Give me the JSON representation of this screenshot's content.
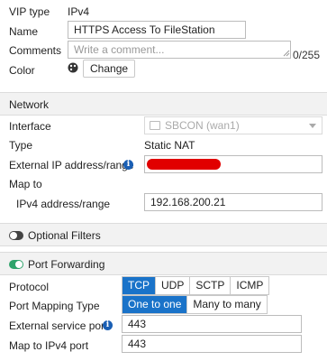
{
  "vip_type": {
    "label": "VIP type",
    "value": "IPv4"
  },
  "name": {
    "label": "Name",
    "value": "HTTPS Access To FileStation"
  },
  "comments": {
    "label": "Comments",
    "placeholder": "Write a comment...",
    "counter": "0/255"
  },
  "color": {
    "label": "Color",
    "button": "Change"
  },
  "network": {
    "title": "Network",
    "interface": {
      "label": "Interface",
      "value": "SBCON (wan1)"
    },
    "type": {
      "label": "Type",
      "value": "Static NAT"
    },
    "external_ip": {
      "label": "External IP address/range"
    },
    "map_to": {
      "label": "Map to"
    },
    "ipv4_range": {
      "label": "IPv4 address/range",
      "value": "192.168.200.21"
    }
  },
  "optional_filters": {
    "title": "Optional Filters",
    "enabled": false
  },
  "port_forwarding": {
    "title": "Port Forwarding",
    "enabled": true,
    "protocol": {
      "label": "Protocol",
      "options": [
        "TCP",
        "UDP",
        "SCTP",
        "ICMP"
      ],
      "selected": "TCP"
    },
    "port_mapping": {
      "label": "Port Mapping Type",
      "options": [
        "One to one",
        "Many to many"
      ],
      "selected": "One to one"
    },
    "external_port": {
      "label": "External service port",
      "value": "443"
    },
    "map_port": {
      "label": "Map to IPv4 port",
      "value": "443"
    }
  }
}
